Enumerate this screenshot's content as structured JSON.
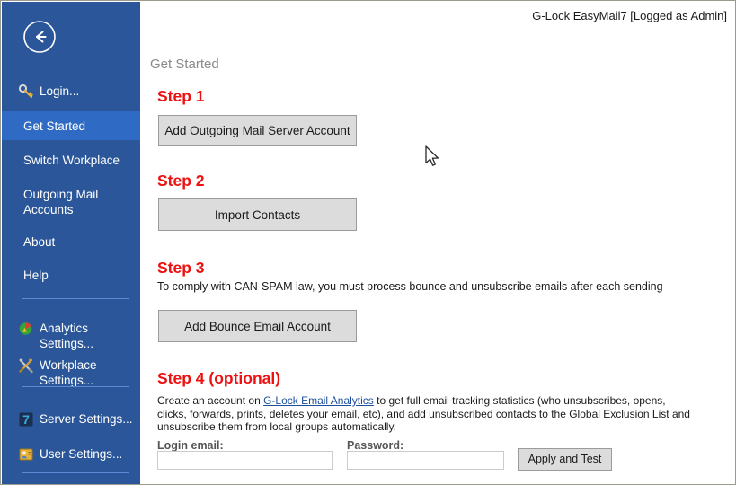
{
  "window": {
    "titlebar_text": "G-Lock EasyMail7 [Logged as Admin]",
    "sidebar_color": "#2b579a",
    "selected_color": "#2f6bc4",
    "accent_red": "#ee1111",
    "link_color": "#1b4f9c"
  },
  "sidebar": {
    "back_label": "Back",
    "items": [
      {
        "label": "Login...",
        "icon": "key-icon",
        "selected": false
      },
      {
        "label": "Get Started",
        "icon": null,
        "selected": true
      },
      {
        "label": "Switch  Workplace",
        "icon": null,
        "selected": false
      },
      {
        "label": "Outgoing Mail Accounts",
        "icon": null,
        "selected": false
      },
      {
        "label": "About",
        "icon": null,
        "selected": false
      },
      {
        "label": "Help",
        "icon": null,
        "selected": false
      },
      {
        "label": "Analytics Settings...",
        "icon": "analytics-pie-icon",
        "selected": false
      },
      {
        "label": "Workplace Settings...",
        "icon": "tools-icon",
        "selected": false
      },
      {
        "label": "Server Settings...",
        "icon": "server-seven-icon",
        "selected": false
      },
      {
        "label": "User Settings...",
        "icon": "user-card-icon",
        "selected": false
      }
    ]
  },
  "main": {
    "page_title": "Get Started",
    "steps": [
      {
        "heading": "Step 1",
        "button": "Add Outgoing Mail Server Account",
        "description": null
      },
      {
        "heading": "Step 2",
        "button": "Import Contacts",
        "description": null
      },
      {
        "heading": "Step 3",
        "button": "Add Bounce Email Account",
        "description": "To comply with CAN-SPAM law, you must process bounce and unsubscribe emails after each sending"
      },
      {
        "heading": "Step 4 (optional)",
        "button": null,
        "description": null
      }
    ],
    "step4": {
      "paragraph_part1": "Create an account on ",
      "link_text": "G-Lock Email Analytics",
      "paragraph_part2": " to get full email tracking statistics (who unsubscribes, opens, clicks, forwards, prints, deletes your email, etc), and add unsubscribed contacts to the Global Exclusion List and unsubscribe them from local groups automatically.",
      "login_email_label": "Login email:",
      "login_email_value": "",
      "password_label": "Password:",
      "password_value": "",
      "apply_button": "Apply and Test"
    }
  }
}
